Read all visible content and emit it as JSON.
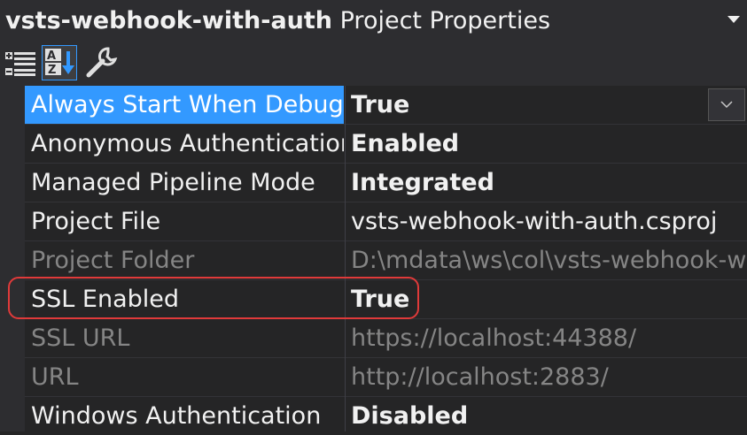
{
  "header": {
    "project_name": "vsts-webhook-with-auth",
    "title_suffix": "Project Properties"
  },
  "toolbar": {
    "buttons": [
      "categorized-icon",
      "alphabetical-icon",
      "property-pages-icon"
    ],
    "selected": "alphabetical"
  },
  "properties": [
    {
      "name": "Always Start When Debugging",
      "value": "True"
    },
    {
      "name": "Anonymous Authentication",
      "value": "Enabled"
    },
    {
      "name": "Managed Pipeline Mode",
      "value": "Integrated"
    },
    {
      "name": "Project File",
      "value": "vsts-webhook-with-auth.csproj"
    },
    {
      "name": "Project Folder",
      "value": "D:\\mdata\\ws\\col\\vsts-webhook-w"
    },
    {
      "name": "SSL Enabled",
      "value": "True"
    },
    {
      "name": "SSL URL",
      "value": "https://localhost:44388/"
    },
    {
      "name": "URL",
      "value": "http://localhost:2883/"
    },
    {
      "name": "Windows Authentication",
      "value": "Disabled"
    }
  ],
  "colors": {
    "background": "#252526",
    "selection": "#3399ff",
    "highlight_ring": "#e03a3a",
    "disabled_text": "#858585"
  }
}
